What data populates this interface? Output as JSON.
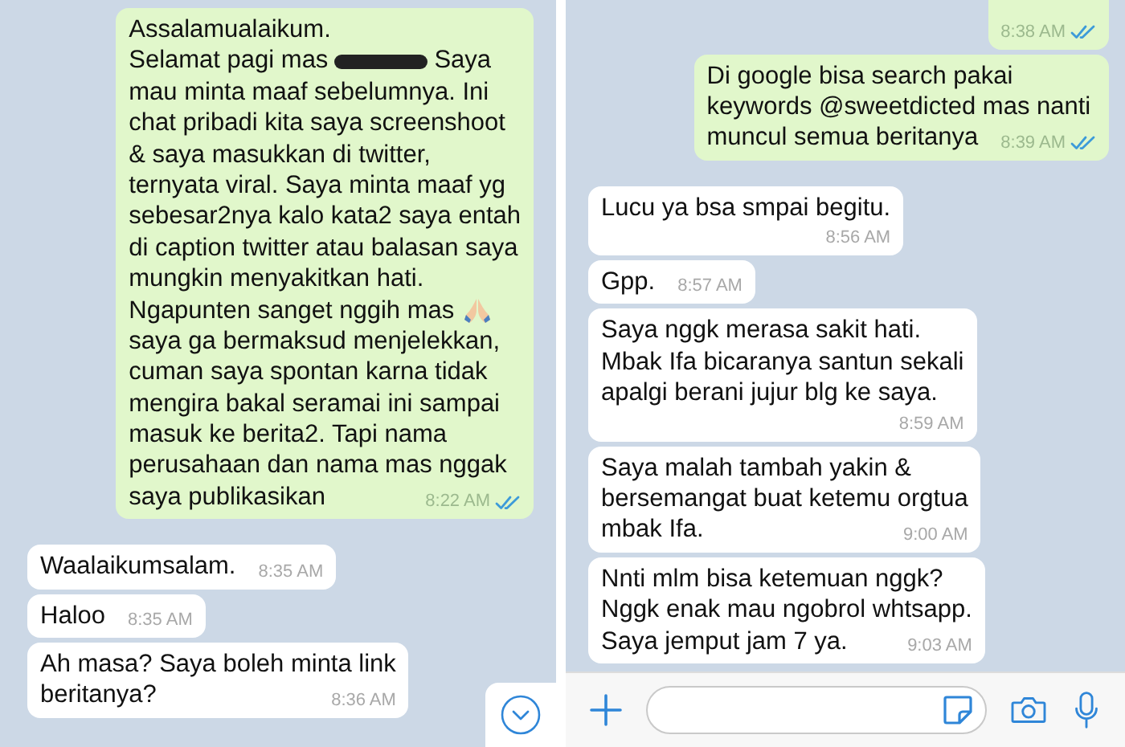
{
  "panels": [
    {
      "show_scroll_button": true,
      "composer": false,
      "messages": [
        {
          "outgoing": true,
          "segments": [
            {
              "kind": "text",
              "text": "Assalamualaikum.\nSelamat pagi mas"
            },
            {
              "kind": "redacted"
            },
            {
              "kind": "text",
              "text": "Saya\nmau minta maaf sebelumnya. Ini\nchat pribadi kita saya screenshoot\n& saya masukkan di twitter,\nternyata viral. Saya minta maaf yg\nsebesar2nya kalo kata2 saya entah\ndi caption twitter atau balasan saya\nmungkin menyakitkan hati.\nNgapunten sanget nggih mas"
            },
            {
              "kind": "emoji"
            },
            {
              "kind": "text",
              "text": "\nsaya ga bermaksud menjelekkan,\ncuman saya spontan karna tidak\nmengira bakal seramai ini sampai\nmasuk ke berita2. Tapi nama\nperusahaan dan nama mas nggak\nsaya publikasikan"
            }
          ],
          "time": "8:22 AM",
          "read": true
        },
        {
          "outgoing": false,
          "text": "Waalaikumsalam.",
          "time": "8:35 AM"
        },
        {
          "outgoing": false,
          "text": "Haloo",
          "time": "8:35 AM"
        },
        {
          "outgoing": false,
          "text": "Ah masa? Saya boleh minta link\nberitanya?",
          "time": "8:36 AM"
        }
      ]
    },
    {
      "show_scroll_button": false,
      "composer": true,
      "messages": [
        {
          "outgoing": true,
          "time": "8:38 AM",
          "read": true,
          "clipped_top": true
        },
        {
          "outgoing": true,
          "text": "Di google bisa search pakai\nkeywords @sweetdicted mas nanti\nmuncul semua beritanya",
          "time": "8:39 AM",
          "read": true
        },
        {
          "outgoing": false,
          "text": "Lucu ya bsa smpai begitu.",
          "time": "8:56 AM",
          "time_on_new_line": true
        },
        {
          "outgoing": false,
          "text": "Gpp.",
          "time": "8:57 AM"
        },
        {
          "outgoing": false,
          "text": "Saya nggk merasa sakit hati.\nMbak Ifa bicaranya santun sekali\napalgi berani jujur blg ke saya.",
          "time": "8:59 AM",
          "time_on_new_line": true
        },
        {
          "outgoing": false,
          "text": "Saya malah tambah yakin &\nbersemangat buat ketemu orgtua\nmbak Ifa.",
          "time": "9:00 AM"
        },
        {
          "outgoing": false,
          "text": "Nnti mlm bisa ketemuan nggk?\nNggk enak mau ngobrol whtsapp.\nSaya jemput jam 7 ya.",
          "time": "9:03 AM"
        }
      ]
    }
  ]
}
